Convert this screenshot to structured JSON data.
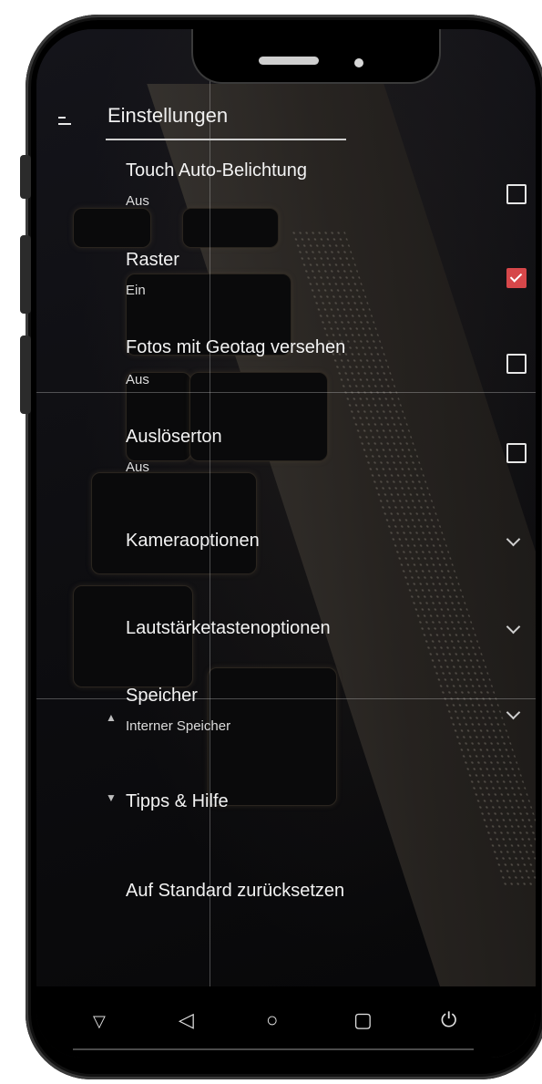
{
  "header": {
    "title": "Einstellungen"
  },
  "settings": {
    "touch_auto_exposure": {
      "label": "Touch Auto-Belichtung",
      "value": "Aus",
      "checked": false
    },
    "grid": {
      "label": "Raster",
      "value": "Ein",
      "checked": true
    },
    "geotag": {
      "label": "Fotos mit Geotag versehen",
      "value": "Aus",
      "checked": false
    },
    "shutter_sound": {
      "label": "Auslöserton",
      "value": "Aus",
      "checked": false
    },
    "camera_options": {
      "label": "Kameraoptionen"
    },
    "volume_key_options": {
      "label": "Lautstärketastenoptionen"
    },
    "storage": {
      "label": "Speicher",
      "value": "Interner Speicher"
    },
    "tips_help": {
      "label": "Tipps & Hilfe"
    },
    "reset": {
      "label": "Auf Standard zurücksetzen"
    }
  },
  "colors": {
    "accent": "#d6474a",
    "background": "#0d0d0f",
    "text": "#f2f2f2"
  },
  "icons": {
    "menu": "menu-icon",
    "checkbox": "checkbox-icon",
    "chevron": "chevron-down-icon",
    "nav_back": "back-triangle-icon",
    "nav_home": "home-circle-icon",
    "nav_recents": "recents-square-icon",
    "nav_power": "power-icon",
    "nav_hide": "hide-nav-icon"
  }
}
